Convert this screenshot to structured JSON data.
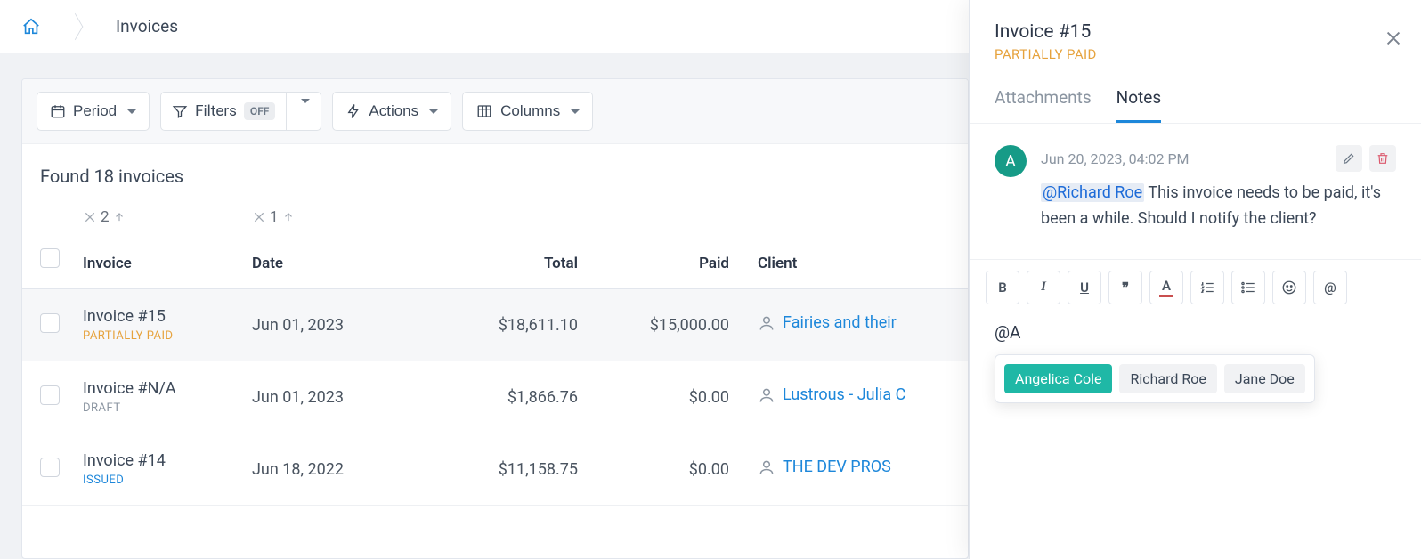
{
  "breadcrumb": {
    "title": "Invoices"
  },
  "toolbar": {
    "period": "Period",
    "filters": "Filters",
    "filters_badge": "OFF",
    "actions": "Actions",
    "columns": "Columns"
  },
  "list": {
    "found_label": "Found 18 invoices",
    "columns": {
      "invoice": "Invoice",
      "date": "Date",
      "total": "Total",
      "paid": "Paid",
      "client": "Client"
    },
    "sort": {
      "invoice": "2",
      "date": "1"
    },
    "rows": [
      {
        "title": "Invoice #15",
        "status": "PARTIALLY PAID",
        "status_class": "status-pp",
        "date": "Jun 01, 2023",
        "total": "$18,611.10",
        "paid": "$15,000.00",
        "client": "Fairies and their "
      },
      {
        "title": "Invoice #N/A",
        "status": "DRAFT",
        "status_class": "status-draft",
        "date": "Jun 01, 2023",
        "total": "$1,866.76",
        "paid": "$0.00",
        "client": "Lustrous - Julia C"
      },
      {
        "title": "Invoice #14",
        "status": "ISSUED",
        "status_class": "status-issued",
        "date": "Jun 18, 2022",
        "total": "$11,158.75",
        "paid": "$0.00",
        "client": "THE DEV PROS"
      }
    ]
  },
  "panel": {
    "title": "Invoice #15",
    "status": "PARTIALLY PAID",
    "tabs": {
      "attachments": "Attachments",
      "notes": "Notes"
    },
    "note": {
      "avatar": "A",
      "date": "Jun 20, 2023, 04:02 PM",
      "mention": "@Richard Roe",
      "text": " This invoice needs to be paid, it's been a while. Should I notify the client?"
    },
    "editor_text": "@A",
    "suggestions": [
      "Angelica Cole",
      "Richard Roe",
      "Jane Doe"
    ],
    "tools": {
      "bold": "B",
      "italic": "I",
      "underline": "U",
      "quote": "❞",
      "color": "A",
      "ol": "ol",
      "ul": "ul",
      "emoji": "☺",
      "mention": "@"
    }
  }
}
